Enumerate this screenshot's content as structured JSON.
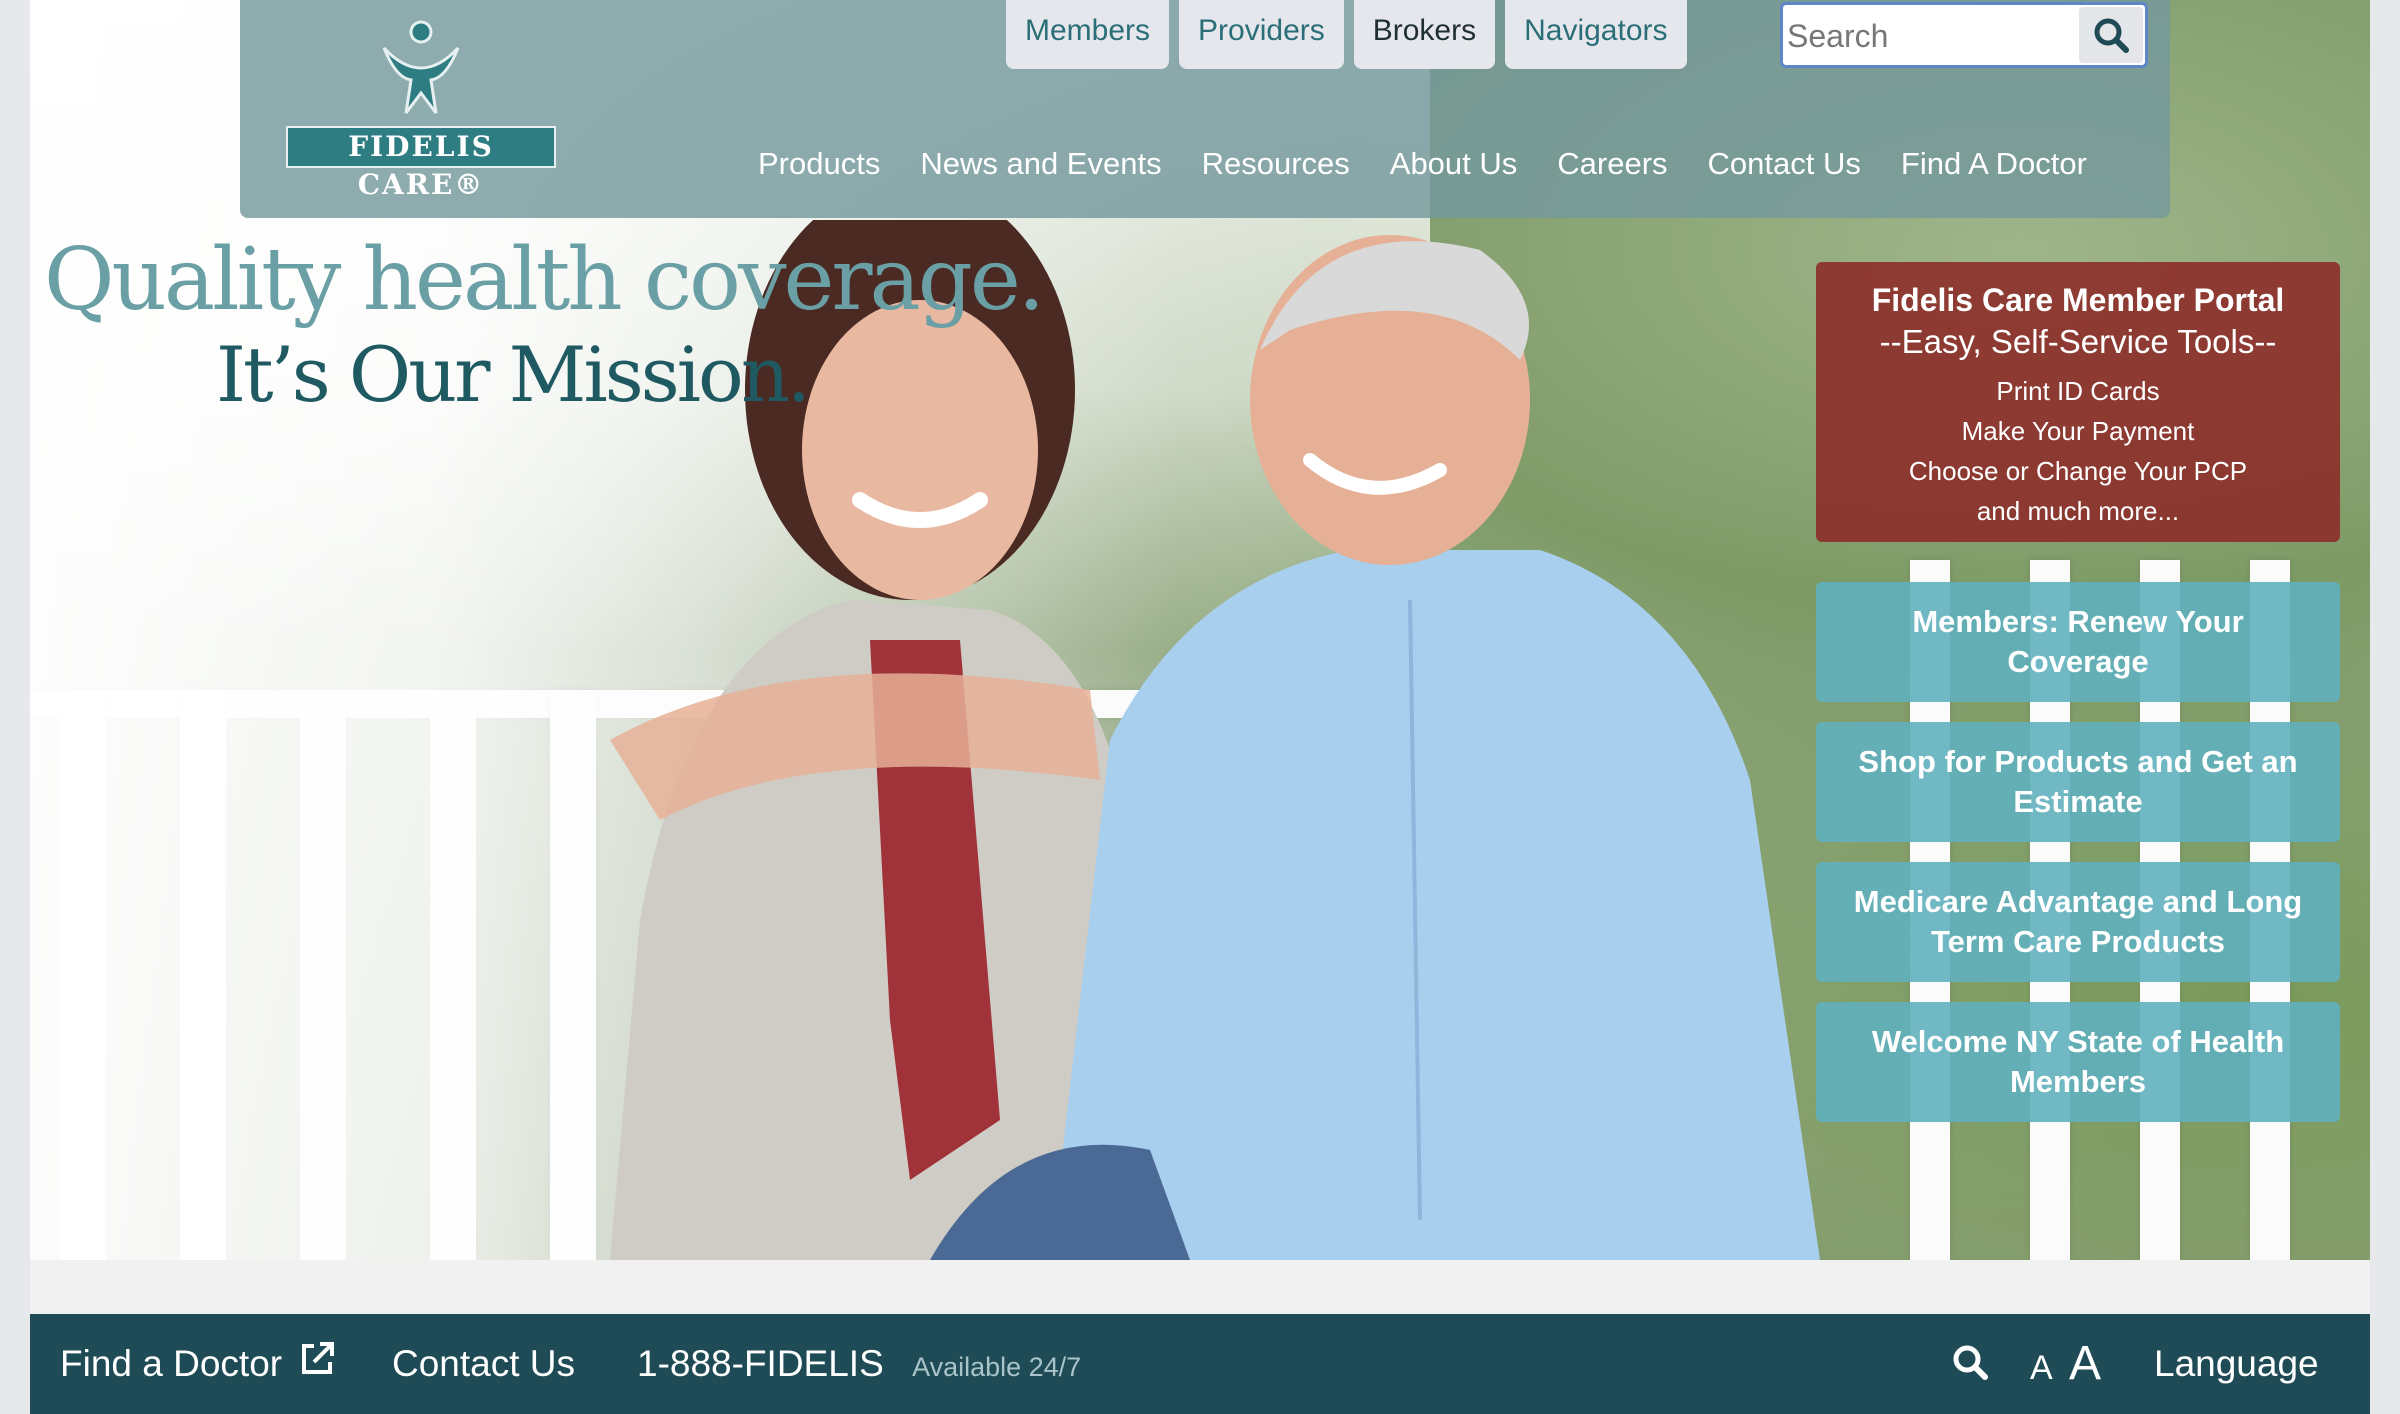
{
  "header": {
    "logo_text": "FIDELIS CARE®",
    "top_tabs": [
      "Members",
      "Providers",
      "Brokers",
      "Navigators"
    ],
    "search": {
      "placeholder": "Search"
    },
    "main_nav": [
      "Products",
      "News and Events",
      "Resources",
      "About Us",
      "Careers",
      "Contact Us",
      "Find A Doctor"
    ]
  },
  "hero": {
    "tagline_line1": "Quality health coverage.",
    "tagline_line2": "It’s Our Mission."
  },
  "portal": {
    "title": "Fidelis Care Member Portal",
    "subtitle": "--Easy, Self-Service Tools--",
    "items": [
      "Print ID Cards",
      "Make Your Payment",
      "Choose or Change Your PCP",
      "and much more..."
    ]
  },
  "ctas": [
    "Members: Renew Your Coverage",
    "Shop for Products and Get an Estimate",
    "Medicare Advantage and Long Term Care Products",
    "Welcome NY State of Health Members"
  ],
  "footer": {
    "find_doctor": "Find a Doctor",
    "contact": "Contact Us",
    "phone": "1-888-FIDELIS",
    "availability": "Available 24/7",
    "text_size_small": "A",
    "text_size_large": "A",
    "language": "Language"
  },
  "colors": {
    "header_bg": "#75989c",
    "portal_bg": "#8c2a28",
    "cta_bg": "#60b0be",
    "footer_bg": "#1e4b55",
    "tagline_light": "#6aa0a5",
    "tagline_dark": "#1f5961"
  }
}
